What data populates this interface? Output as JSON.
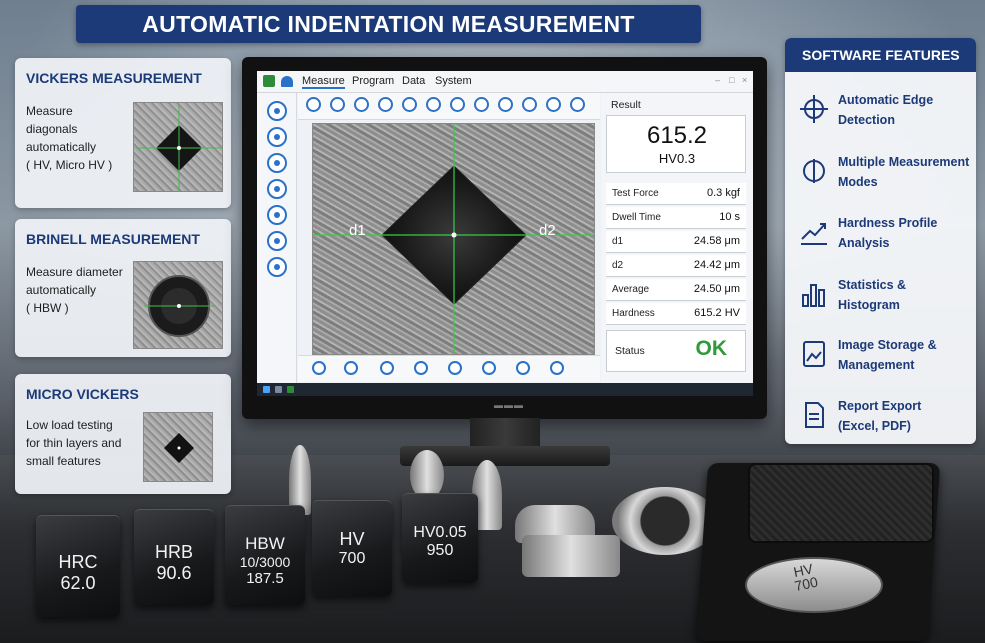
{
  "banner": {
    "title": "AUTOMATIC INDENTATION MEASUREMENT"
  },
  "cards": [
    {
      "title": "VICKERS MEASUREMENT",
      "lines": [
        "Measure diagonals",
        "automatically",
        "( HV, Micro HV )"
      ]
    },
    {
      "title": "BRINELL MEASUREMENT",
      "lines": [
        "Measure diameter",
        "automatically",
        "( HBW )"
      ]
    },
    {
      "title": "MICRO VICKERS",
      "lines": [
        "Low load testing",
        "for thin layers and",
        "small features"
      ]
    }
  ],
  "features": {
    "title": "SOFTWARE FEATURES",
    "items": [
      {
        "icon": "crosshair-icon",
        "line1": "Automatic Edge",
        "line2": "Detection"
      },
      {
        "icon": "target-icon",
        "line1": "Multiple Measurement",
        "line2": "Modes"
      },
      {
        "icon": "trend-chart-icon",
        "line1": "Hardness Profile",
        "line2": "Analysis"
      },
      {
        "icon": "bar-chart-icon",
        "line1": "Statistics &",
        "line2": "Histogram"
      },
      {
        "icon": "image-icon",
        "line1": "Image Storage &",
        "line2": "Management"
      },
      {
        "icon": "document-icon",
        "line1": "Report Export",
        "line2": "(Excel, PDF)"
      }
    ]
  },
  "software": {
    "menu": [
      "Measure",
      "Program",
      "Data",
      "System"
    ],
    "image_labels": {
      "d1": "d1",
      "d2": "d2"
    },
    "result_title": "Result",
    "result_value": "615.2",
    "result_unit": "HV0.3",
    "rows": [
      {
        "key": "Test Force",
        "value": "0.3 kgf"
      },
      {
        "key": "Dwell Time",
        "value": "10 s"
      },
      {
        "key": "d1",
        "value": "24.58 μm"
      },
      {
        "key": "d2",
        "value": "24.42 μm"
      },
      {
        "key": "Average",
        "value": "24.50 μm"
      },
      {
        "key": "Hardness",
        "value": "615.2 HV"
      }
    ],
    "status_label": "Status",
    "status_value": "OK"
  },
  "blocks": [
    {
      "line1": "HRC",
      "line2": "62.0"
    },
    {
      "line1": "HRB",
      "line2": "90.6"
    },
    {
      "line1": "HBW",
      "line2": "10/3000",
      "line3": "187.5"
    },
    {
      "line1": "HV",
      "line2": "700"
    },
    {
      "line1": "HV0.05",
      "line2": "950"
    }
  ],
  "disc": {
    "line1": "HV",
    "line2": "700"
  },
  "colors": {
    "brand_blue": "#1c3a78",
    "accent_blue": "#2a72c9",
    "ok_green": "#2e9a3a"
  }
}
